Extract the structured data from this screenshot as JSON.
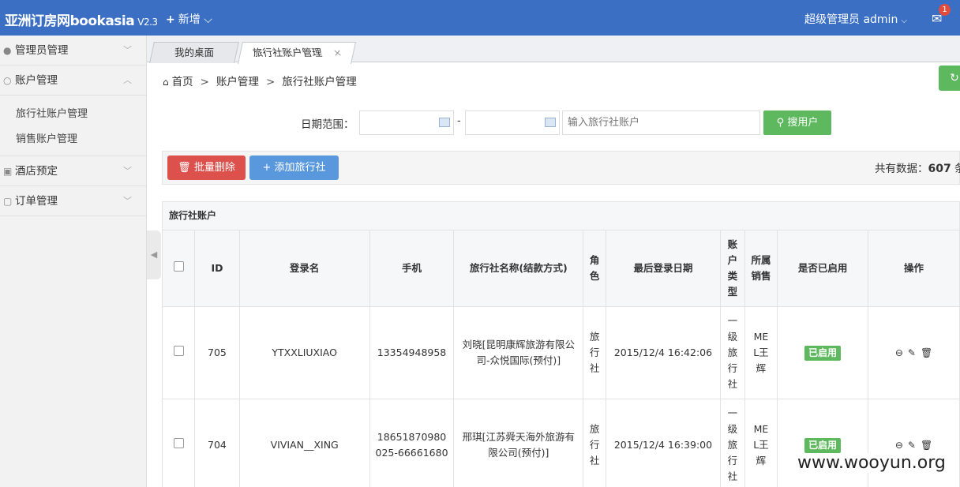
{
  "app": {
    "title": "亚洲订房网bookasia",
    "version": "V2.3",
    "add_new": "新增",
    "user": "超级管理员  admin",
    "mail_count": "1"
  },
  "sidebar": {
    "items": [
      {
        "label": "管理员管理"
      },
      {
        "label": "账户管理"
      },
      {
        "label": "酒店预定"
      },
      {
        "label": "订单管理"
      }
    ],
    "sub_items": [
      {
        "label": "旅行社账户管理"
      },
      {
        "label": "销售账户管理"
      }
    ]
  },
  "tabs": [
    {
      "label": "我的桌面"
    },
    {
      "label": "旅行社账户管理",
      "close": "×"
    }
  ],
  "breadcrumb": {
    "home": "首页",
    "sep": ">",
    "level1": "账户管理",
    "level2": "旅行社账户管理"
  },
  "filter": {
    "label": "日期范围：",
    "dash": "-",
    "search_placeholder": "输入旅行社账户",
    "search_button": "搜用户"
  },
  "actions": {
    "batch_delete": "批量删除",
    "add_agency": "添加旅行社",
    "total_prefix": "共有数据：",
    "total_count": "607",
    "total_suffix": "条"
  },
  "table": {
    "title": "旅行社账户",
    "headers": [
      "ID",
      "登录名",
      "手机",
      "旅行社名称(结款方式)",
      "角色",
      "最后登录日期",
      "账户类型",
      "所属销售",
      "是否已启用",
      "操作"
    ],
    "rows": [
      {
        "id": "705",
        "login": "YTXXLIUXIAO",
        "phone": "13354948958",
        "phone2": "",
        "agency": "刘晓[昆明康辉旅游有限公司-众悦国际(预付)]",
        "role": "旅行社",
        "last_login": "2015/12/4 16:42:06",
        "account_type": "一级旅行社",
        "sales": "MEL王辉",
        "status": "已启用"
      },
      {
        "id": "704",
        "login": "VIVIAN__XING",
        "phone": "18651870980",
        "phone2": "025-66661680",
        "agency": "邢琪[江苏舜天海外旅游有限公司(预付)]",
        "role": "旅行社",
        "last_login": "2015/12/4 16:39:00",
        "account_type": "一级旅行社",
        "sales": "MEL王辉",
        "status": "已启用"
      }
    ]
  },
  "watermark": "www.wooyun.org"
}
